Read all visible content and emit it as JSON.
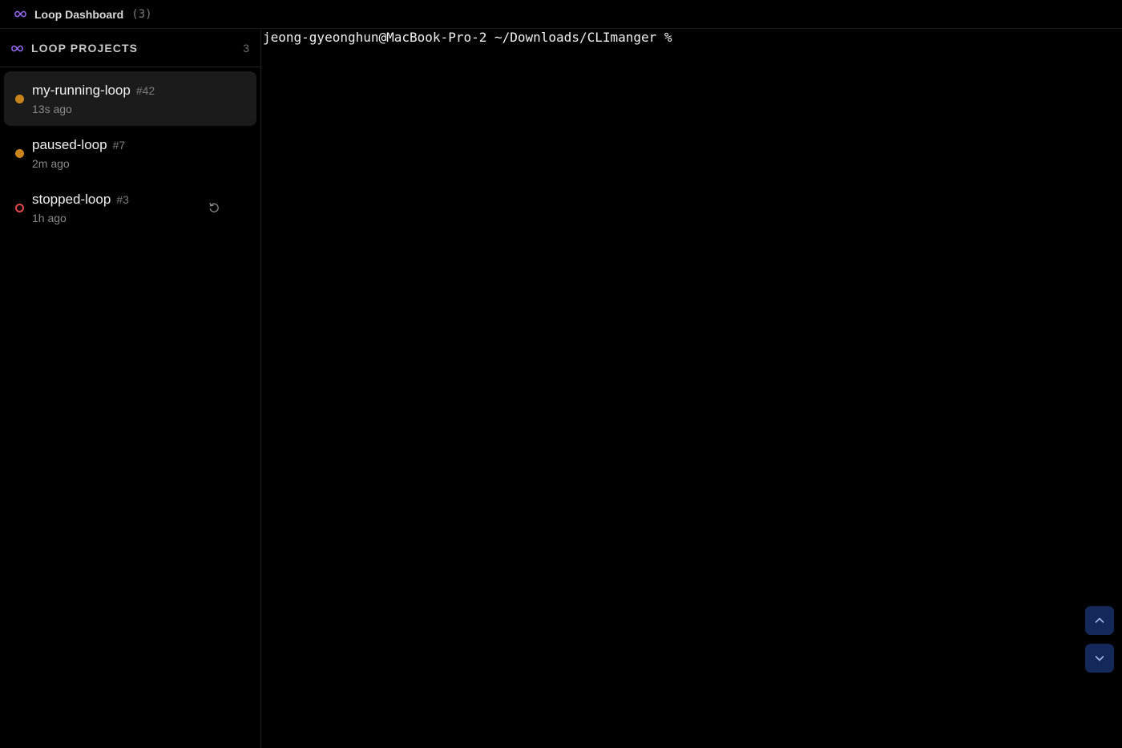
{
  "titlebar": {
    "title": "Loop Dashboard",
    "count": "(3)",
    "icon": "infinity-icon"
  },
  "sidebar": {
    "header_label": "LOOP PROJECTS",
    "header_count": "3",
    "icon": "infinity-icon",
    "items": [
      {
        "name": "my-running-loop",
        "id": "#42",
        "time": "13s ago",
        "status": "running",
        "status_color": "#c9851c",
        "active": true
      },
      {
        "name": "paused-loop",
        "id": "#7",
        "time": "2m ago",
        "status": "paused",
        "status_color": "#c9851c",
        "active": false
      },
      {
        "name": "stopped-loop",
        "id": "#3",
        "time": "1h ago",
        "status": "stopped",
        "status_color": "#e5484d",
        "active": false,
        "action_icon": "restart-icon"
      }
    ]
  },
  "terminal": {
    "prompt": "jeong-gyeonghun@MacBook-Pro-2 ~/Downloads/CLImanger %"
  },
  "scroll_controls": {
    "up_icon": "chevron-up-icon",
    "down_icon": "chevron-down-icon",
    "button_color": "#14285a"
  },
  "colors": {
    "accent": "#9b6cff",
    "running": "#c9851c",
    "stopped": "#e5484d"
  }
}
